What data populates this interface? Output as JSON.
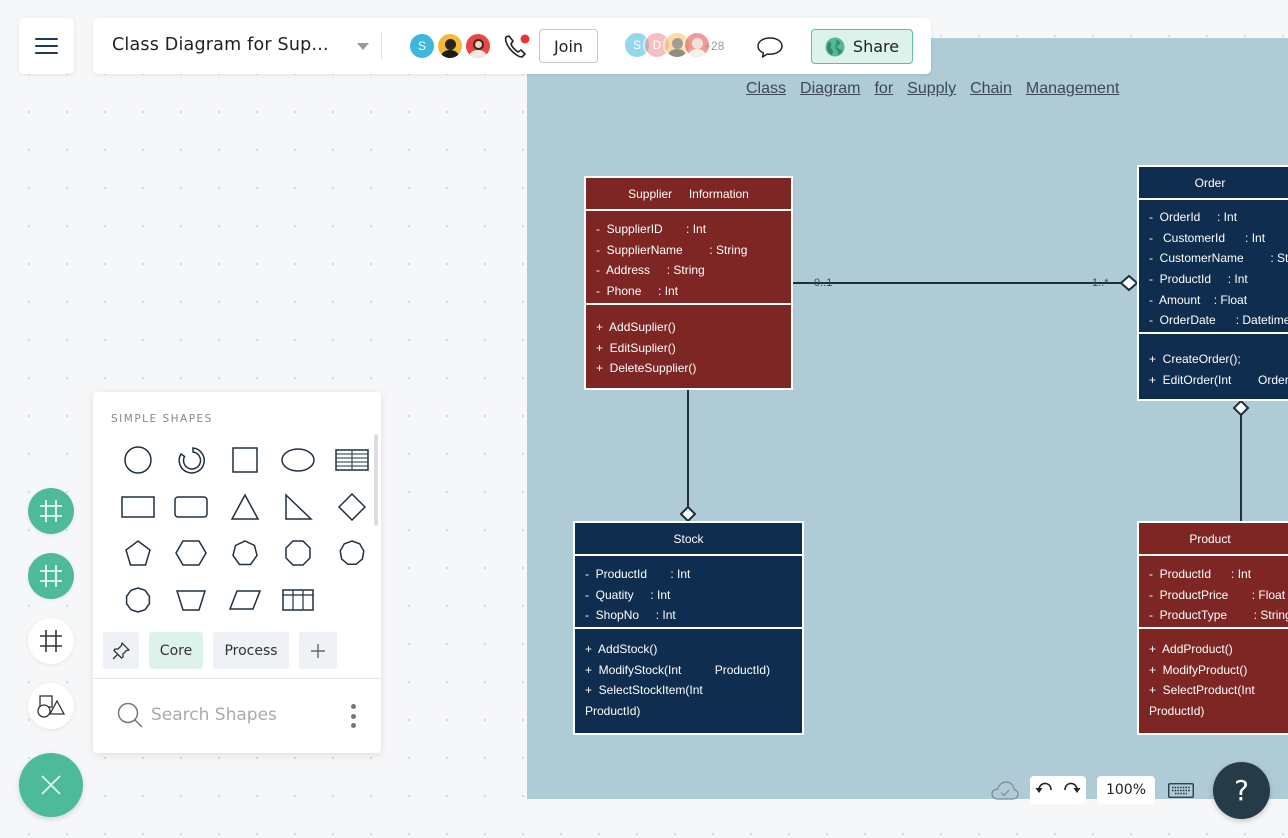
{
  "header": {
    "menu_icon": "hamburger-menu-icon",
    "document_title": "Class Diagram for Sup...",
    "collaborators": [
      {
        "initial": "S",
        "color": "#3fb6dd"
      },
      {
        "initial": "",
        "color": "#f3b93a"
      },
      {
        "initial": "",
        "color": "#e94848"
      }
    ],
    "call_icon": "phone-call-icon",
    "call_status_color": "#e5343a",
    "join_label": "Join",
    "viewers": [
      {
        "initial": "S",
        "color": "#3fb6dd"
      },
      {
        "initial": "D",
        "color": "#f08a8a"
      },
      {
        "initial": "",
        "color": "#f3c35a"
      },
      {
        "initial": "",
        "color": "#e94848"
      }
    ],
    "viewers_more": "+28",
    "comment_icon": "comment-icon",
    "share_label": "Share",
    "share_icon": "globe-icon"
  },
  "diagram": {
    "title_words": [
      "Class",
      "Diagram",
      "for",
      "Supply",
      "Chain",
      "Management"
    ],
    "colors": {
      "red": "#7e2624",
      "blue": "#0f2d4e",
      "canvas": "#aecbd6"
    },
    "classes": {
      "supplier": {
        "name": "Supplier     Information",
        "attributes": [
          "-  SupplierID       : Int",
          "-  SupplierName        : String",
          "-  Address     : String",
          "-  Phone     : Int"
        ],
        "operations": [
          "+  AddSuplier()",
          "+  EditSuplier()",
          "+  DeleteSupplier()"
        ]
      },
      "order": {
        "name": "Order",
        "attributes": [
          "-  OrderId     : Int",
          "-   CustomerId      : Int",
          "-  CustomerName        : String",
          "-  ProductId     : Int",
          "-  Amount    : Float",
          "-  OrderDate      : Datetime"
        ],
        "operations": [
          "+  CreateOrder();",
          "+  EditOrder(Int        OrderId)"
        ]
      },
      "stock": {
        "name": "Stock",
        "attributes": [
          "-  ProductId       : Int",
          "-  Quatity     : Int",
          "-  ShopNo     : Int"
        ],
        "operations": [
          "+  AddStock()",
          "+  ModifyStock(Int          ProductId)",
          "+  SelectStockItem(Int",
          "ProductId)"
        ]
      },
      "product": {
        "name": "Product",
        "attributes": [
          "-  ProductId      : Int",
          "-  ProductPrice       : Float",
          "-  ProductType        : String"
        ],
        "operations": [
          "+  AddProduct()",
          "+  ModifyProduct()",
          "+  SelectProduct(Int",
          "ProductId)"
        ]
      }
    },
    "multiplicities": {
      "supplier_end": "0..1",
      "order_end": "1..*"
    }
  },
  "shapes_panel": {
    "heading": "SIMPLE SHAPES",
    "shapes": [
      "circle",
      "ring",
      "square",
      "ellipse",
      "table-lines",
      "rectangle",
      "rounded-rectangle",
      "triangle",
      "right-triangle",
      "diamond",
      "pentagon",
      "hexagon",
      "heptagon",
      "octagon",
      "nonagon",
      "decagon",
      "trapezoid",
      "parallelogram",
      "grid-table"
    ],
    "tabs": [
      {
        "label": "",
        "icon": "pin-icon"
      },
      {
        "label": "Core",
        "active": true
      },
      {
        "label": "Process"
      },
      {
        "label": "",
        "icon": "plus-icon"
      }
    ],
    "search_placeholder": "Search Shapes"
  },
  "left_tools": [
    {
      "name": "frame-tool-1",
      "icon": "frame-icon",
      "style": "green"
    },
    {
      "name": "frame-tool-2",
      "icon": "frame-icon",
      "style": "green"
    },
    {
      "name": "frame-tool-3",
      "icon": "frame-icon",
      "style": "white"
    },
    {
      "name": "shapes-tool",
      "icon": "shapes-icon",
      "style": "white"
    }
  ],
  "bottom_controls": {
    "cloud_saved_icon": "cloud-check-icon",
    "undo_icon": "undo-icon",
    "redo_icon": "redo-icon",
    "zoom_level": "100%",
    "keyboard_icon": "keyboard-icon",
    "help_label": "?"
  }
}
